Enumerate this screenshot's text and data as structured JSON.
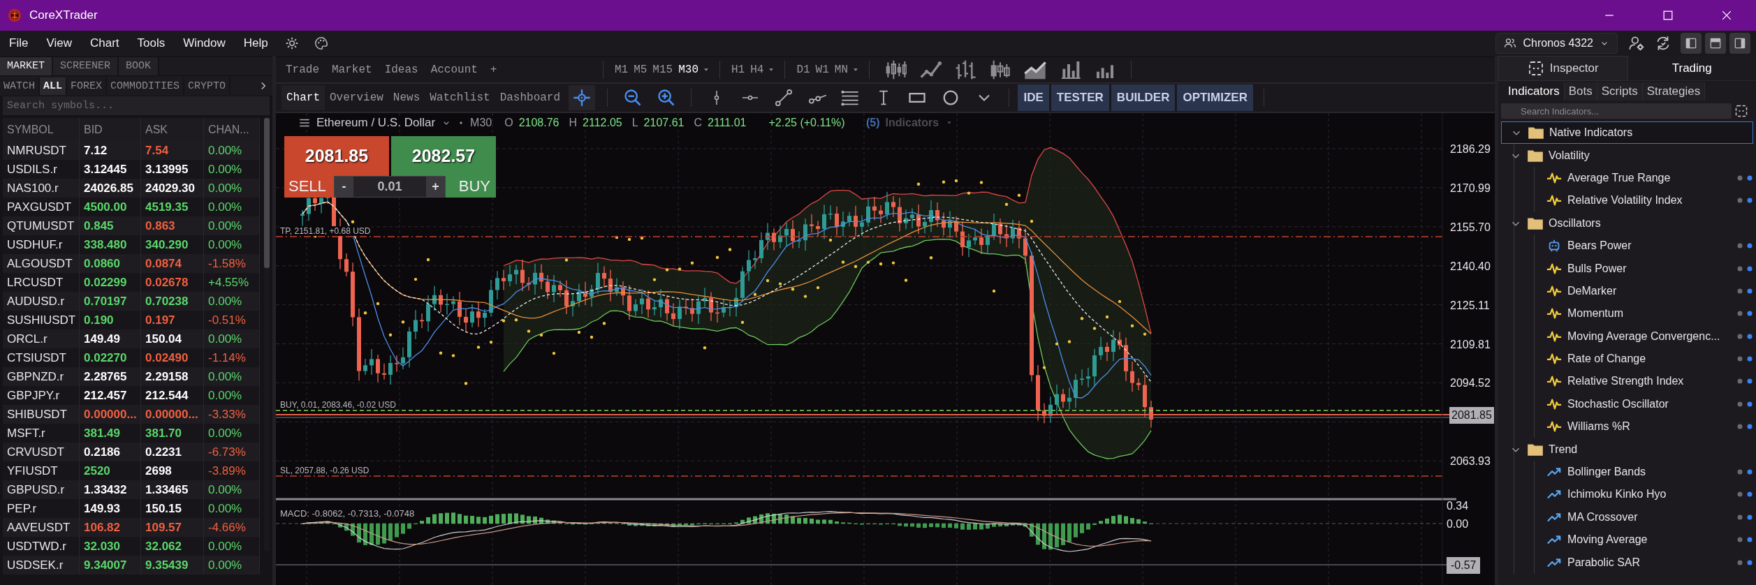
{
  "window": {
    "title": "CoreXTrader"
  },
  "menu": [
    "File",
    "View",
    "Chart",
    "Tools",
    "Window",
    "Help"
  ],
  "account": {
    "label": "Chronos 4322"
  },
  "market_panel": {
    "tabs": [
      {
        "label": "MARKET",
        "selected": true
      },
      {
        "label": "SCREENER",
        "selected": false
      },
      {
        "label": "BOOK",
        "selected": false
      }
    ],
    "filters": [
      {
        "label": "WATCH",
        "selected": false
      },
      {
        "label": "ALL",
        "selected": true
      },
      {
        "label": "FOREX",
        "selected": false
      },
      {
        "label": "COMMODITIES",
        "selected": false
      },
      {
        "label": "CRYPTO",
        "selected": false
      }
    ],
    "search": {
      "placeholder": "Search symbols..."
    },
    "columns": [
      "SYMBOL",
      "BID",
      "ASK",
      "CHAN..."
    ],
    "rows": [
      {
        "symbol": "NMRUSDT",
        "bid": {
          "text": "7.12",
          "color": "#ffffff"
        },
        "ask": {
          "text": "7.54",
          "color": "#f0603f"
        },
        "change": {
          "text": "0.00%",
          "color": "#5ad86a"
        }
      },
      {
        "symbol": "USDILS.r",
        "bid": {
          "text": "3.12445",
          "color": "#ffffff"
        },
        "ask": {
          "text": "3.13995",
          "color": "#ffffff"
        },
        "change": {
          "text": "0.00%",
          "color": "#5ad86a"
        }
      },
      {
        "symbol": "NAS100.r",
        "bid": {
          "text": "24026.85",
          "color": "#ffffff"
        },
        "ask": {
          "text": "24029.30",
          "color": "#ffffff"
        },
        "change": {
          "text": "0.00%",
          "color": "#5ad86a"
        }
      },
      {
        "symbol": "PAXGUSDT",
        "bid": {
          "text": "4500.00",
          "color": "#5ad86a"
        },
        "ask": {
          "text": "4519.35",
          "color": "#5ad86a"
        },
        "change": {
          "text": "0.00%",
          "color": "#5ad86a"
        }
      },
      {
        "symbol": "QTUMUSDT",
        "bid": {
          "text": "0.845",
          "color": "#5ad86a"
        },
        "ask": {
          "text": "0.863",
          "color": "#f0603f"
        },
        "change": {
          "text": "0.00%",
          "color": "#5ad86a"
        }
      },
      {
        "symbol": "USDHUF.r",
        "bid": {
          "text": "338.480",
          "color": "#5ad86a"
        },
        "ask": {
          "text": "340.290",
          "color": "#5ad86a"
        },
        "change": {
          "text": "0.00%",
          "color": "#5ad86a"
        }
      },
      {
        "symbol": "ALGOUSDT",
        "bid": {
          "text": "0.0860",
          "color": "#5ad86a"
        },
        "ask": {
          "text": "0.0874",
          "color": "#f0603f"
        },
        "change": {
          "text": "-1.58%",
          "color": "#f0603f"
        }
      },
      {
        "symbol": "LRCUSDT",
        "bid": {
          "text": "0.02299",
          "color": "#5ad86a"
        },
        "ask": {
          "text": "0.02678",
          "color": "#f0603f"
        },
        "change": {
          "text": "+4.55%",
          "color": "#5ad86a"
        }
      },
      {
        "symbol": "AUDUSD.r",
        "bid": {
          "text": "0.70197",
          "color": "#5ad86a"
        },
        "ask": {
          "text": "0.70238",
          "color": "#5ad86a"
        },
        "change": {
          "text": "0.00%",
          "color": "#5ad86a"
        }
      },
      {
        "symbol": "SUSHIUSDT",
        "bid": {
          "text": "0.190",
          "color": "#5ad86a"
        },
        "ask": {
          "text": "0.197",
          "color": "#f0603f"
        },
        "change": {
          "text": "-0.51%",
          "color": "#f0603f"
        }
      },
      {
        "symbol": "ORCL.r",
        "bid": {
          "text": "149.49",
          "color": "#ffffff"
        },
        "ask": {
          "text": "150.04",
          "color": "#ffffff"
        },
        "change": {
          "text": "0.00%",
          "color": "#5ad86a"
        }
      },
      {
        "symbol": "CTSIUSDT",
        "bid": {
          "text": "0.02270",
          "color": "#5ad86a"
        },
        "ask": {
          "text": "0.02490",
          "color": "#f0603f"
        },
        "change": {
          "text": "-1.14%",
          "color": "#f0603f"
        }
      },
      {
        "symbol": "GBPNZD.r",
        "bid": {
          "text": "2.28765",
          "color": "#ffffff"
        },
        "ask": {
          "text": "2.29158",
          "color": "#ffffff"
        },
        "change": {
          "text": "0.00%",
          "color": "#5ad86a"
        }
      },
      {
        "symbol": "GBPJPY.r",
        "bid": {
          "text": "212.457",
          "color": "#ffffff"
        },
        "ask": {
          "text": "212.544",
          "color": "#ffffff"
        },
        "change": {
          "text": "0.00%",
          "color": "#5ad86a"
        }
      },
      {
        "symbol": "SHIBUSDT",
        "bid": {
          "text": "0.00000...",
          "color": "#f0603f"
        },
        "ask": {
          "text": "0.00000...",
          "color": "#f0603f"
        },
        "change": {
          "text": "-3.33%",
          "color": "#f0603f"
        }
      },
      {
        "symbol": "MSFT.r",
        "bid": {
          "text": "381.49",
          "color": "#5ad86a"
        },
        "ask": {
          "text": "381.70",
          "color": "#5ad86a"
        },
        "change": {
          "text": "0.00%",
          "color": "#5ad86a"
        }
      },
      {
        "symbol": "CRVUSDT",
        "bid": {
          "text": "0.2186",
          "color": "#ffffff"
        },
        "ask": {
          "text": "0.2231",
          "color": "#ffffff"
        },
        "change": {
          "text": "-6.73%",
          "color": "#f0603f"
        }
      },
      {
        "symbol": "YFIUSDT",
        "bid": {
          "text": "2520",
          "color": "#5ad86a"
        },
        "ask": {
          "text": "2698",
          "color": "#ffffff"
        },
        "change": {
          "text": "-3.89%",
          "color": "#f0603f"
        }
      },
      {
        "symbol": "GBPUSD.r",
        "bid": {
          "text": "1.33432",
          "color": "#ffffff"
        },
        "ask": {
          "text": "1.33465",
          "color": "#ffffff"
        },
        "change": {
          "text": "0.00%",
          "color": "#5ad86a"
        }
      },
      {
        "symbol": "PEP.r",
        "bid": {
          "text": "149.93",
          "color": "#ffffff"
        },
        "ask": {
          "text": "150.15",
          "color": "#ffffff"
        },
        "change": {
          "text": "0.00%",
          "color": "#5ad86a"
        }
      },
      {
        "symbol": "AAVEUSDT",
        "bid": {
          "text": "106.82",
          "color": "#f0603f"
        },
        "ask": {
          "text": "109.57",
          "color": "#f0603f"
        },
        "change": {
          "text": "-4.66%",
          "color": "#f0603f"
        }
      },
      {
        "symbol": "USDTWD.r",
        "bid": {
          "text": "32.030",
          "color": "#5ad86a"
        },
        "ask": {
          "text": "32.062",
          "color": "#5ad86a"
        },
        "change": {
          "text": "0.00%",
          "color": "#5ad86a"
        }
      },
      {
        "symbol": "USDSEK.r",
        "bid": {
          "text": "9.34007",
          "color": "#5ad86a"
        },
        "ask": {
          "text": "9.35439",
          "color": "#5ad86a"
        },
        "change": {
          "text": "0.00%",
          "color": "#5ad86a"
        }
      }
    ]
  },
  "toolbar": {
    "menu_tabs": [
      "Trade",
      "Market",
      "Ideas",
      "Account",
      "+"
    ],
    "timeframe_groups": [
      [
        {
          "label": "M1",
          "selected": false
        },
        {
          "label": "M5",
          "selected": false
        },
        {
          "label": "M15",
          "selected": false
        },
        {
          "label": "M30",
          "selected": true
        }
      ],
      [
        {
          "label": "H1",
          "selected": false
        },
        {
          "label": "H4",
          "selected": false
        }
      ],
      [
        {
          "label": "D1",
          "selected": false
        },
        {
          "label": "W1",
          "selected": false
        },
        {
          "label": "MN",
          "selected": false
        }
      ]
    ],
    "chart_types": [
      {
        "kind": "candles",
        "selected": false
      },
      {
        "kind": "line",
        "selected": false
      },
      {
        "kind": "bars",
        "selected": false
      },
      {
        "kind": "hollow",
        "selected": false
      },
      {
        "kind": "area",
        "selected": true
      },
      {
        "kind": "columns",
        "selected": false
      },
      {
        "kind": "histogram",
        "selected": false
      }
    ],
    "view_tabs": [
      {
        "label": "Chart",
        "selected": true
      },
      {
        "label": "Overview",
        "selected": false
      },
      {
        "label": "News",
        "selected": false
      },
      {
        "label": "Watchlist",
        "selected": false
      },
      {
        "label": "Dashboard",
        "selected": false
      }
    ],
    "tools": [
      {
        "kind": "crosshair",
        "selected": true
      },
      {
        "kind": "zoom-out",
        "selected": false
      },
      {
        "kind": "zoom-in",
        "selected": false
      },
      {
        "kind": "vline",
        "selected": false
      },
      {
        "kind": "hline",
        "selected": false
      },
      {
        "kind": "trend",
        "selected": false
      },
      {
        "kind": "ray",
        "selected": false
      },
      {
        "kind": "lines",
        "selected": false
      },
      {
        "kind": "text",
        "selected": false
      },
      {
        "kind": "rect",
        "selected": false
      },
      {
        "kind": "circle",
        "selected": false
      },
      {
        "kind": "more",
        "selected": false
      }
    ],
    "modules": [
      "IDE",
      "TESTER",
      "BUILDER",
      "OPTIMIZER"
    ]
  },
  "chart": {
    "symbol": "Ethereum / U.S. Dollar",
    "timeframe": "M30",
    "ohlc": [
      {
        "label": "O",
        "value": "2108.76"
      },
      {
        "label": "H",
        "value": "2112.05"
      },
      {
        "label": "L",
        "value": "2107.61"
      },
      {
        "label": "C",
        "value": "2111.01"
      }
    ],
    "change": "+2.25 (+0.11%)",
    "indicators_count": "(5)",
    "indicators_label": "Indicators",
    "trade": {
      "sell_price": "2081.85",
      "buy_price": "2082.57",
      "sell_label": "SELL",
      "buy_label": "BUY",
      "lot": "0.01",
      "minus": "-",
      "plus": "+"
    },
    "order_lines": [
      {
        "kind": "tp",
        "label": "TP, 2151.81, +0.68 USD"
      },
      {
        "kind": "buy",
        "label": "BUY, 0.01, 2083.46, -0.02 USD"
      },
      {
        "kind": "sl",
        "label": "SL, 2057.88, -0.26 USD"
      }
    ],
    "price_ticks": [
      "2186.29",
      "2170.99",
      "2155.70",
      "2140.40",
      "2125.11",
      "2109.81",
      "2094.52",
      "2063.93"
    ],
    "current_price": "2081.85",
    "macd": {
      "label": "MACD: -0.8062, -0.7313, -0.0748",
      "ticks": [
        "0.34",
        "0.00"
      ],
      "current": "-0.57"
    }
  },
  "side_panel": {
    "tabs": [
      {
        "label": "Inspector",
        "selected": false
      },
      {
        "label": "Trading",
        "selected": true
      }
    ],
    "sub_tabs": [
      {
        "label": "Indicators",
        "selected": true
      },
      {
        "label": "Bots",
        "selected": false
      },
      {
        "label": "Scripts",
        "selected": false
      },
      {
        "label": "Strategies",
        "selected": false
      }
    ],
    "search": {
      "placeholder": "Search Indicators..."
    },
    "tree": [
      {
        "label": "Native Indicators",
        "kind": "folder",
        "expanded": true,
        "selected": true,
        "children": [
          {
            "label": "Volatility",
            "kind": "folder",
            "expanded": true,
            "selected": false,
            "children": [
              {
                "label": "Average True Range",
                "kind": "oscillator",
                "selected": false
              },
              {
                "label": "Relative Volatility Index",
                "kind": "oscillator",
                "selected": false
              }
            ]
          },
          {
            "label": "Oscillators",
            "kind": "folder",
            "expanded": true,
            "selected": false,
            "children": [
              {
                "label": "Bears Power",
                "kind": "bot",
                "selected": false
              },
              {
                "label": "Bulls Power",
                "kind": "oscillator",
                "selected": false
              },
              {
                "label": "DeMarker",
                "kind": "oscillator",
                "selected": false
              },
              {
                "label": "Momentum",
                "kind": "oscillator",
                "selected": false
              },
              {
                "label": "Moving Average Convergenc...",
                "kind": "oscillator",
                "selected": false
              },
              {
                "label": "Rate of Change",
                "kind": "oscillator",
                "selected": false
              },
              {
                "label": "Relative Strength Index",
                "kind": "oscillator",
                "selected": false
              },
              {
                "label": "Stochastic Oscillator",
                "kind": "oscillator",
                "selected": false
              },
              {
                "label": "Williams %R",
                "kind": "oscillator",
                "selected": false
              }
            ]
          },
          {
            "label": "Trend",
            "kind": "folder",
            "expanded": true,
            "selected": false,
            "children": [
              {
                "label": "Bollinger Bands",
                "kind": "trend",
                "selected": false
              },
              {
                "label": "Ichimoku Kinko Hyo",
                "kind": "trend",
                "selected": false
              },
              {
                "label": "MA Crossover",
                "kind": "trend",
                "selected": false
              },
              {
                "label": "Moving Average",
                "kind": "trend",
                "selected": false
              },
              {
                "label": "Parabolic SAR",
                "kind": "trend",
                "selected": false
              }
            ]
          }
        ]
      }
    ]
  }
}
